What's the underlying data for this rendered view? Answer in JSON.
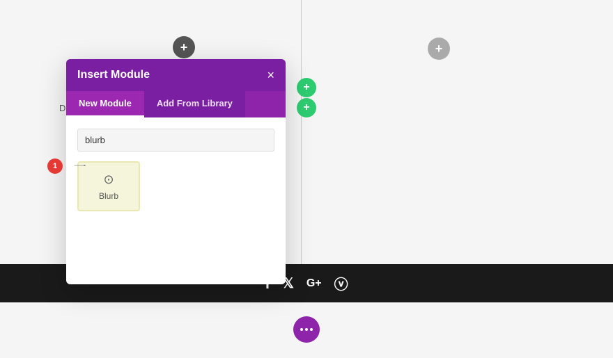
{
  "page": {
    "background_color": "#f5f5f5"
  },
  "modal": {
    "title": "Insert Module",
    "close_label": "×",
    "tabs": [
      {
        "id": "new-module",
        "label": "New Module",
        "active": true
      },
      {
        "id": "add-from-library",
        "label": "Add From Library",
        "active": false
      }
    ],
    "search": {
      "placeholder": "blurb",
      "value": "blurb"
    },
    "modules": [
      {
        "id": "blurb",
        "label": "Blurb",
        "icon": "⊙"
      }
    ]
  },
  "badge": {
    "number": "1"
  },
  "footer": {
    "social_icons": [
      {
        "name": "facebook",
        "symbol": "f"
      },
      {
        "name": "twitter",
        "symbol": "𝕏"
      },
      {
        "name": "google-plus",
        "symbol": "G+"
      },
      {
        "name": "rss",
        "symbol": "⌁"
      }
    ]
  },
  "buttons": {
    "top_plus": "+",
    "right_plus": "+",
    "green_plus_1": "+",
    "green_plus_2": "+",
    "fab_dots_label": "•••"
  },
  "left_partial_text": "D"
}
